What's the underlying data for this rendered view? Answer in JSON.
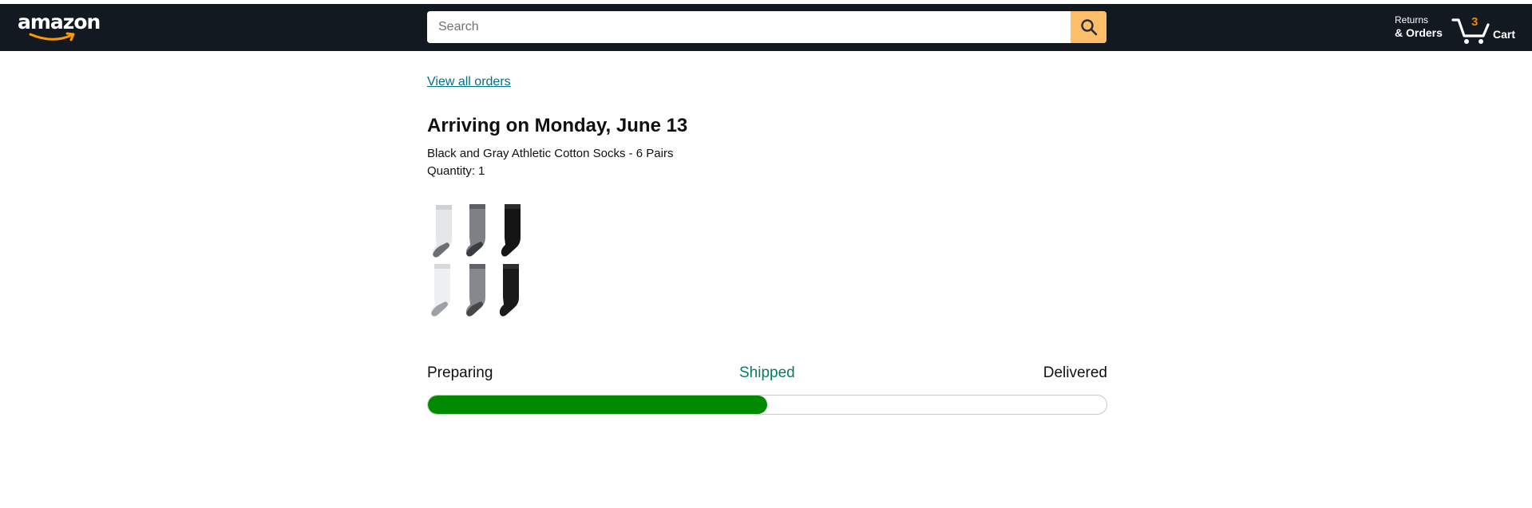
{
  "header": {
    "logo_text": "amazon",
    "search": {
      "placeholder": "Search",
      "value": ""
    },
    "returns": {
      "line1": "Returns",
      "line2": "& Orders"
    },
    "cart": {
      "count": "3",
      "label": "Cart"
    }
  },
  "colors": {
    "nav_background": "#131921",
    "search_button": "#febd69",
    "link": "#007185",
    "shipped_text": "#067d62",
    "progress_fill": "#008a00",
    "cart_count": "#f08804"
  },
  "order": {
    "view_all_link": "View all orders",
    "arrival_title": "Arriving on Monday, June 13",
    "product_name": "Black and Gray Athletic Cotton Socks - 6 Pairs",
    "quantity_label": "Quantity:",
    "quantity_value": "1",
    "image_icon": "socks-image"
  },
  "tracking": {
    "stages": [
      "Preparing",
      "Shipped",
      "Delivered"
    ],
    "current_stage": "Shipped",
    "progress_fraction": 0.5
  }
}
